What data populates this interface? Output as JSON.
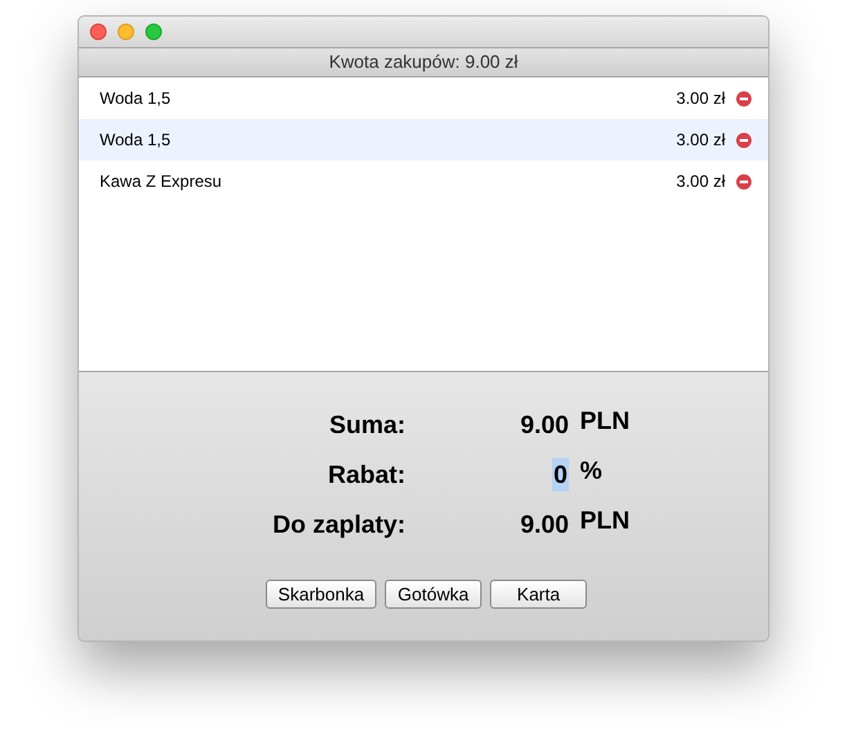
{
  "window": {
    "header": "Kwota zakupów: 9.00 zł"
  },
  "items": [
    {
      "name": "Woda 1,5",
      "price": "3.00 zł"
    },
    {
      "name": "Woda 1,5",
      "price": "3.00 zł"
    },
    {
      "name": "Kawa Z Expresu",
      "price": "3.00 zł"
    }
  ],
  "summary": [
    {
      "kind": "text",
      "label": "Suma:",
      "value": "9.00",
      "unit": "PLN"
    },
    {
      "kind": "field",
      "label": "Rabat:",
      "value": "0",
      "unit": "%"
    },
    {
      "kind": "text",
      "label": "Do zaplaty:",
      "value": "9.00",
      "unit": "PLN"
    }
  ],
  "buttons": [
    "Skarbonka",
    "Gotówka",
    "Karta"
  ]
}
